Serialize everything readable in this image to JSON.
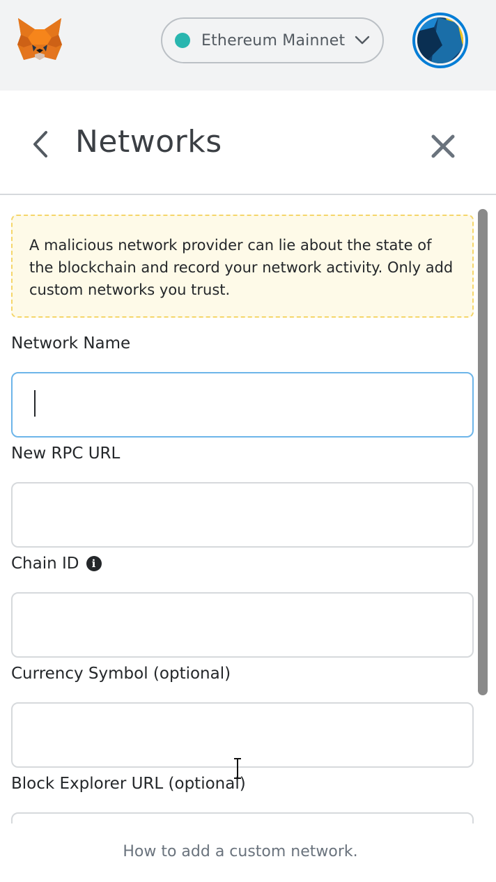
{
  "header": {
    "network": {
      "name": "Ethereum Mainnet",
      "status_color": "#29b6af"
    }
  },
  "page": {
    "title": "Networks"
  },
  "warning": {
    "text": "A malicious network provider can lie about the state of the blockchain and record your network activity. Only add custom networks you trust."
  },
  "form": {
    "fields": [
      {
        "label": "Network Name",
        "value": ""
      },
      {
        "label": "New RPC URL",
        "value": ""
      },
      {
        "label": "Chain ID",
        "value": "",
        "info_icon": "info-icon"
      },
      {
        "label": "Currency Symbol (optional)",
        "value": ""
      },
      {
        "label": "Block Explorer URL (optional)",
        "value": ""
      }
    ]
  },
  "footer": {
    "help_link": "How to add a custom network."
  },
  "colors": {
    "accent": "#037dd6",
    "warning_bg": "#fefae8",
    "warning_border": "#f5d66a"
  }
}
